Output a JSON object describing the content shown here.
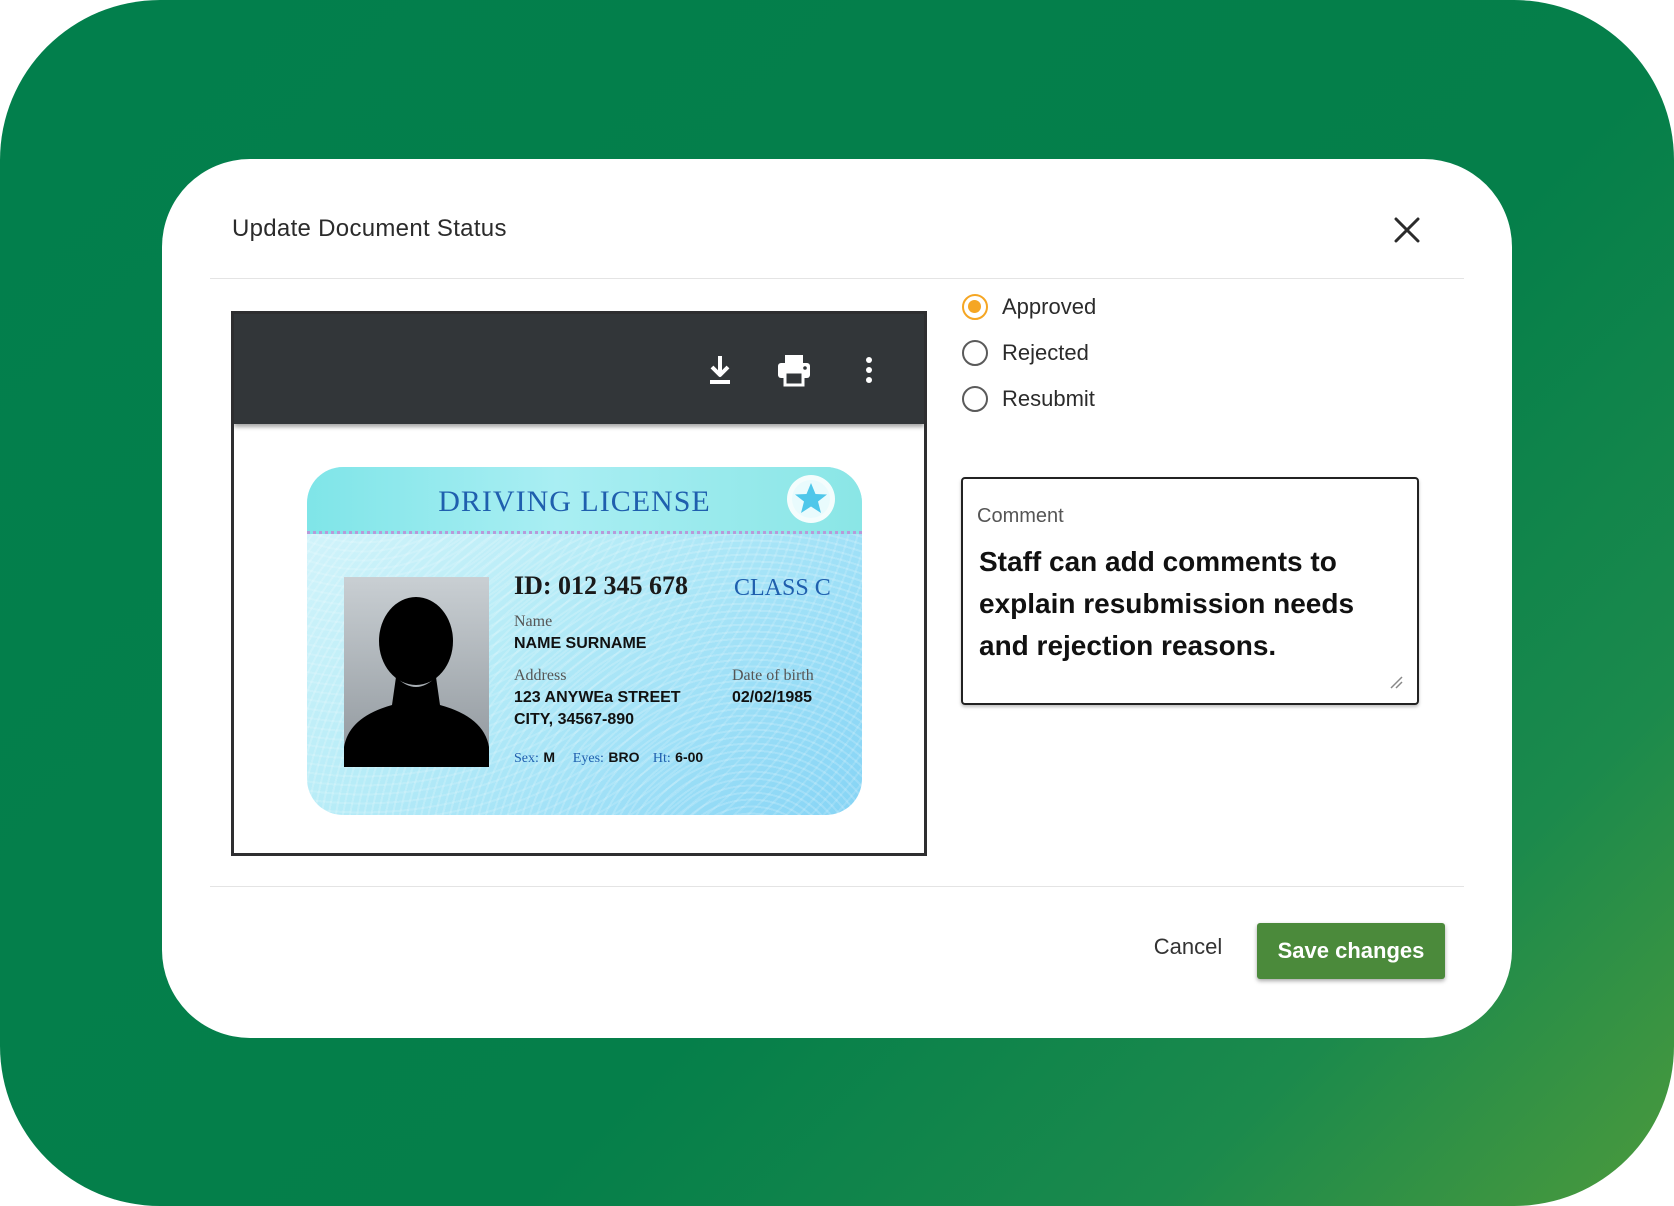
{
  "dialog": {
    "title": "Update Document Status",
    "close_icon": "close-icon"
  },
  "viewer": {
    "toolbar": [
      {
        "name": "download",
        "icon": "download-icon"
      },
      {
        "name": "print",
        "icon": "printer-icon"
      },
      {
        "name": "more",
        "icon": "more-vertical-icon"
      }
    ],
    "license": {
      "title": "DRIVING LICENSE",
      "id": "ID: 012 345 678",
      "class": "CLASS C",
      "name_label": "Name",
      "name_value": "NAME SURNAME",
      "address_label": "Address",
      "address_line1": "123 ANYWEa STREET",
      "address_line2": "CITY, 34567-890",
      "dob_label": "Date of birth",
      "dob_value": "02/02/1985",
      "sex_label": "Sex:",
      "sex_value": "M",
      "eyes_label": "Eyes:",
      "eyes_value": "BRO",
      "height_label": "Ht:",
      "height_value": "6-00"
    }
  },
  "status_options": [
    {
      "label": "Approved",
      "checked": true
    },
    {
      "label": "Rejected",
      "checked": false
    },
    {
      "label": "Resubmit",
      "checked": false
    }
  ],
  "comment": {
    "label": "Comment",
    "value": "Staff can add comments to explain resubmission needs and rejection reasons."
  },
  "footer": {
    "cancel_label": "Cancel",
    "save_label": "Save changes"
  },
  "colors": {
    "accent_radio": "#f5a623",
    "save_button": "#4b8a3b",
    "background_green": "#027f4c"
  }
}
